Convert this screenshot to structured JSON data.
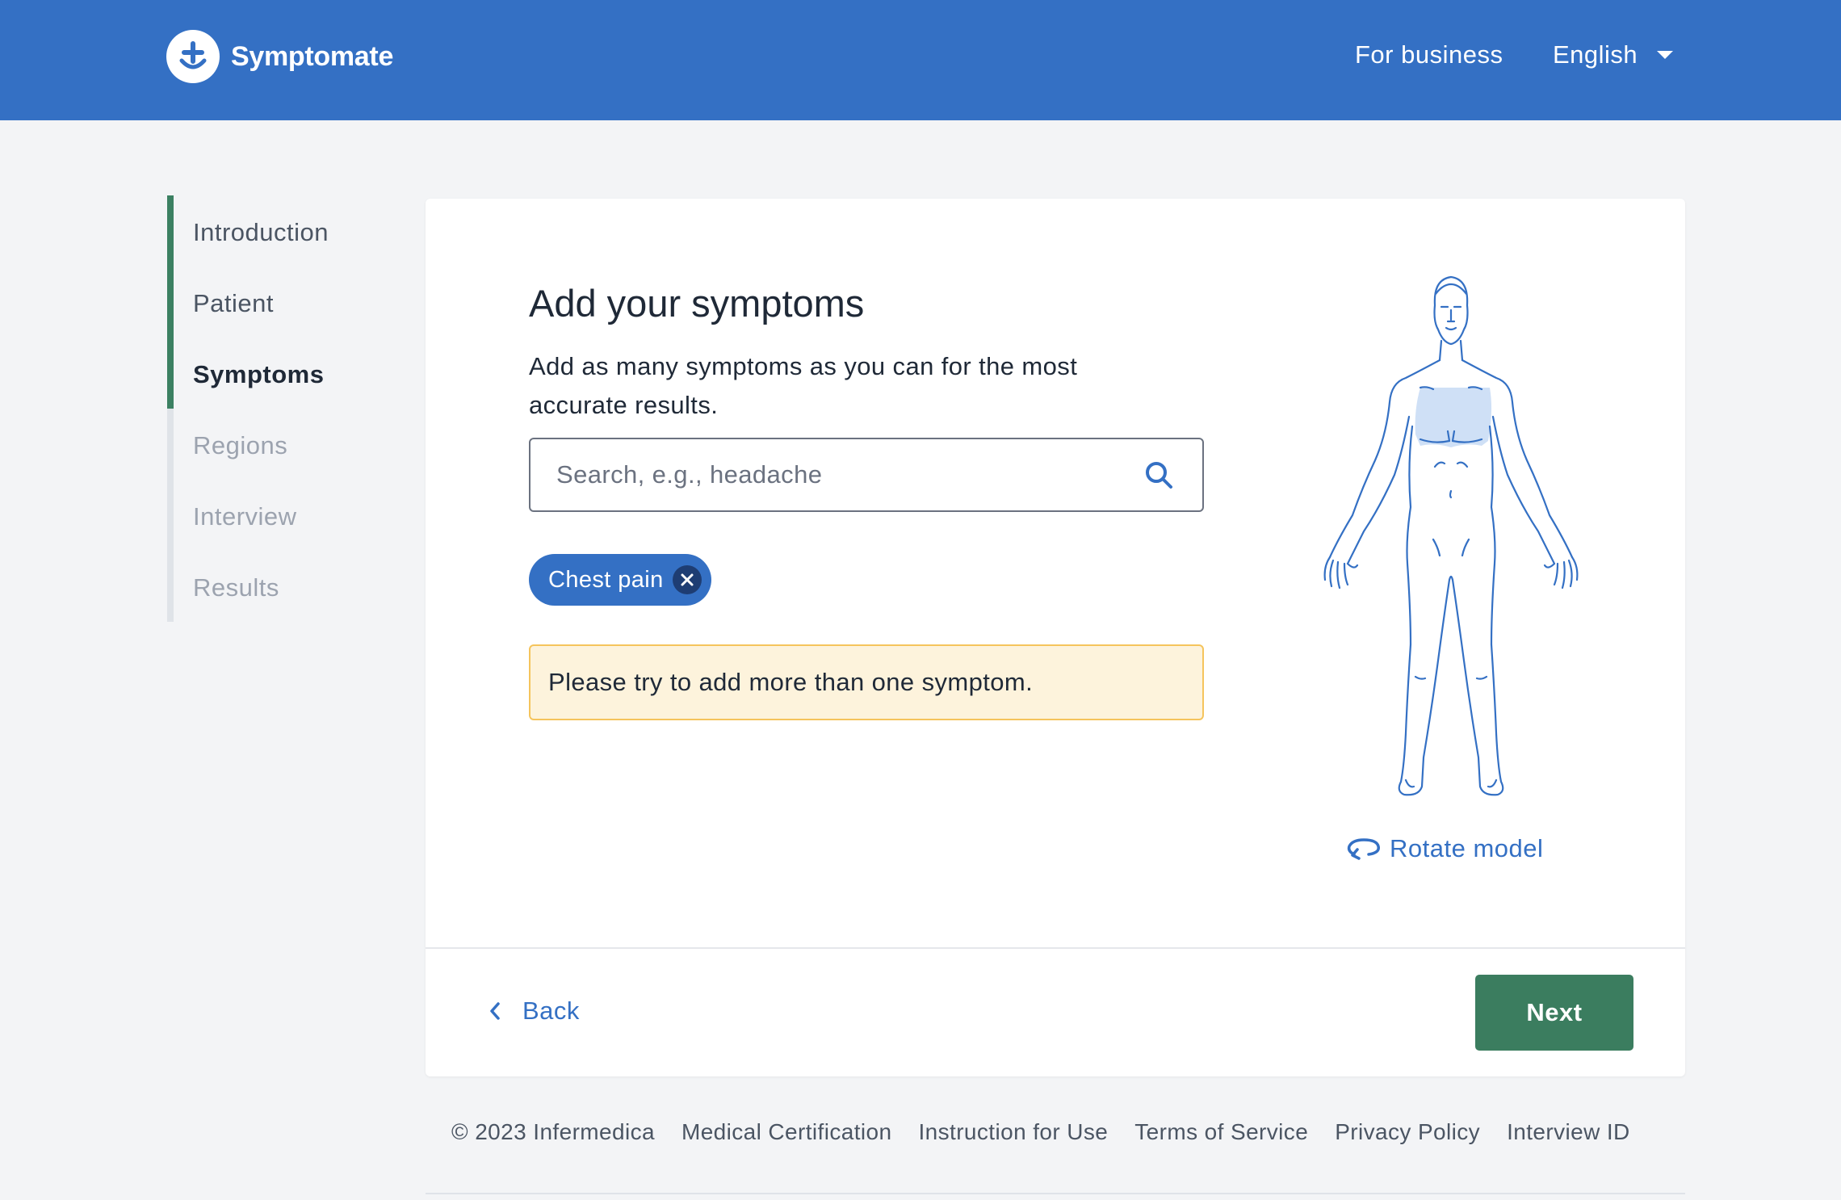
{
  "header": {
    "brand": "Symptomate",
    "for_business": "For business",
    "language": "English"
  },
  "sidebar": {
    "items": [
      {
        "label": "Introduction",
        "state": "done"
      },
      {
        "label": "Patient",
        "state": "done"
      },
      {
        "label": "Symptoms",
        "state": "current"
      },
      {
        "label": "Regions",
        "state": "todo"
      },
      {
        "label": "Interview",
        "state": "todo"
      },
      {
        "label": "Results",
        "state": "todo"
      }
    ]
  },
  "main": {
    "title": "Add your symptoms",
    "subtitle": "Add as many symptoms as you can for the most accurate results.",
    "search": {
      "placeholder": "Search, e.g., headache",
      "value": ""
    },
    "selected_symptoms": [
      "Chest pain"
    ],
    "warning": "Please try to add more than one symptom.",
    "rotate_label": "Rotate model",
    "highlighted_region": "chest"
  },
  "footer_nav": {
    "back_label": "Back",
    "next_label": "Next"
  },
  "footer": {
    "copyright": "© 2023 Infermedica",
    "links": [
      "Medical Certification",
      "Instruction for Use",
      "Terms of Service",
      "Privacy Policy",
      "Interview ID"
    ]
  },
  "colors": {
    "brand_blue": "#3470c4",
    "next_green": "#3b7d5f",
    "progress_green": "#3b8062",
    "warning_bg": "#fdf3dc",
    "warning_border": "#f5c45c"
  }
}
